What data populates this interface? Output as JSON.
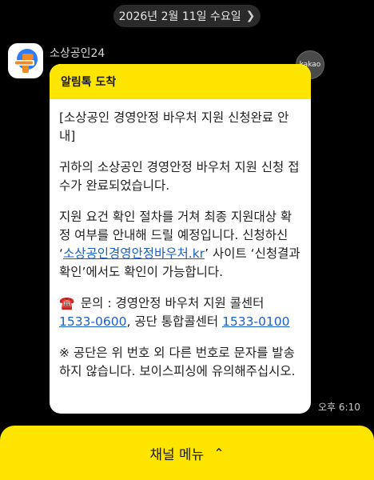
{
  "header": {
    "date": "2026년 2월 11일 수요일",
    "chevron_icon": "chevron-right-icon"
  },
  "sender": {
    "name": "소상공인24",
    "avatar_icon": "brand-logo-icon"
  },
  "badge": {
    "text": "kakao"
  },
  "message": {
    "title": "알림톡 도착",
    "p1": "[소상공인 경영안정 바우처 지원 신청완료 안내]",
    "p2": "귀하의 소상공인 경영안정 바우처 지원 신청 접수가 완료되었습니다.",
    "p3_before": "지원 요건 확인 절차를 거쳐 최종 지원대상 확정 여부를 안내해 드릴 예정입니다. 신청하신 ‘",
    "p3_link": "소상공인경영안정바우처.kr",
    "p3_after": "’ 사이트 ‘신청결과확인’에서도 확인이 가능합니다.",
    "p4_icon": "☎️",
    "p4_before": " 문의 : 경영안정 바우처 지원 콜센터 ",
    "p4_phone1": "1533-0600",
    "p4_middle": ", 공단 통합콜센터 ",
    "p4_phone2": "1533-0100",
    "p5": "※ 공단은 위 번호 외 다른 번호로 문자를 발송하지 않습니다. 보이스피싱에 유의해주십시오."
  },
  "time": "오후 6:10",
  "footer": {
    "label": "채널 메뉴",
    "caret_icon": "caret-up-icon"
  },
  "colors": {
    "accent": "#fee500",
    "link": "#1c5fc4"
  }
}
